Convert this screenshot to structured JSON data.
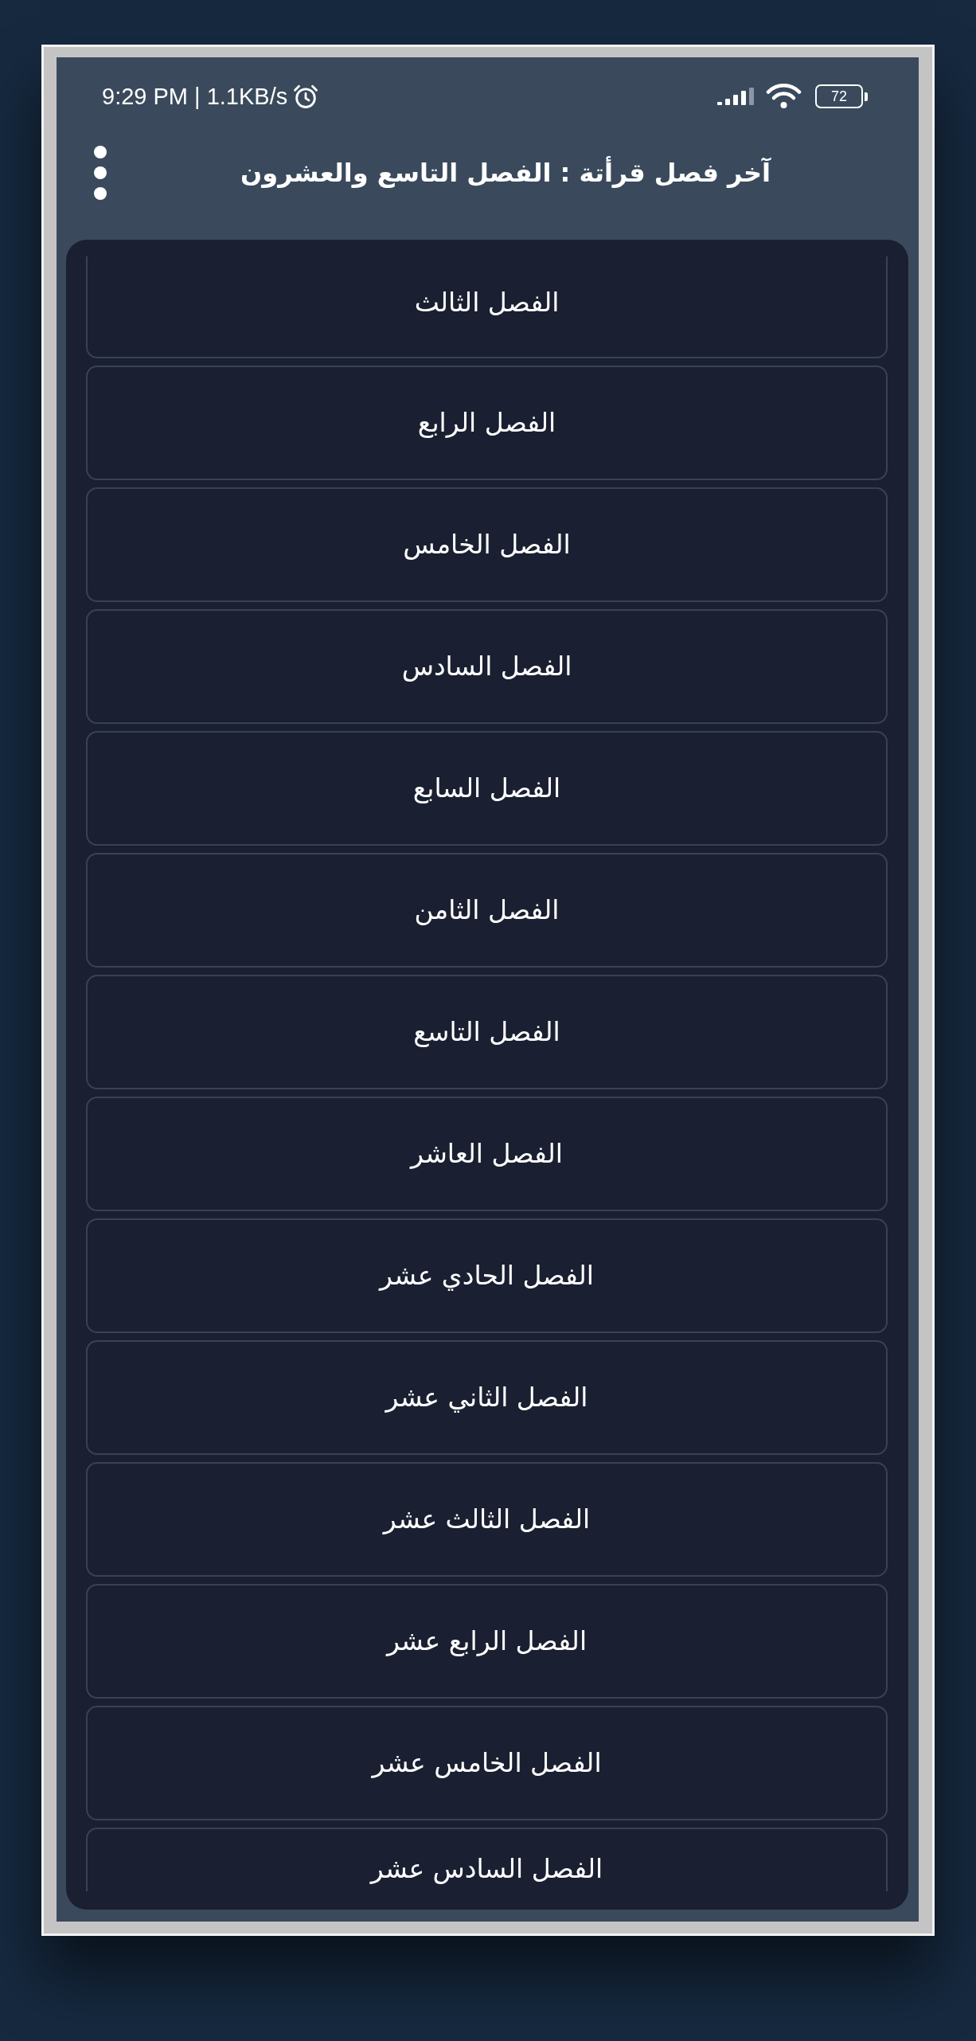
{
  "status_bar": {
    "text": "9:29 PM | 1.1KB/s",
    "battery": "72"
  },
  "app_bar": {
    "title": "آخر فصل قرأتة : الفصل التاسع والعشرون"
  },
  "chapters": [
    {
      "title": "الفصل الثالث"
    },
    {
      "title": "الفصل الرابع"
    },
    {
      "title": "الفصل الخامس"
    },
    {
      "title": "الفصل السادس"
    },
    {
      "title": "الفصل السابع"
    },
    {
      "title": "الفصل الثامن"
    },
    {
      "title": "الفصل التاسع"
    },
    {
      "title": "الفصل العاشر"
    },
    {
      "title": "الفصل الحادي عشر"
    },
    {
      "title": "الفصل الثاني عشر"
    },
    {
      "title": "الفصل الثالث عشر"
    },
    {
      "title": "الفصل الرابع عشر"
    },
    {
      "title": "الفصل الخامس عشر"
    },
    {
      "title": "الفصل السادس عشر"
    }
  ]
}
